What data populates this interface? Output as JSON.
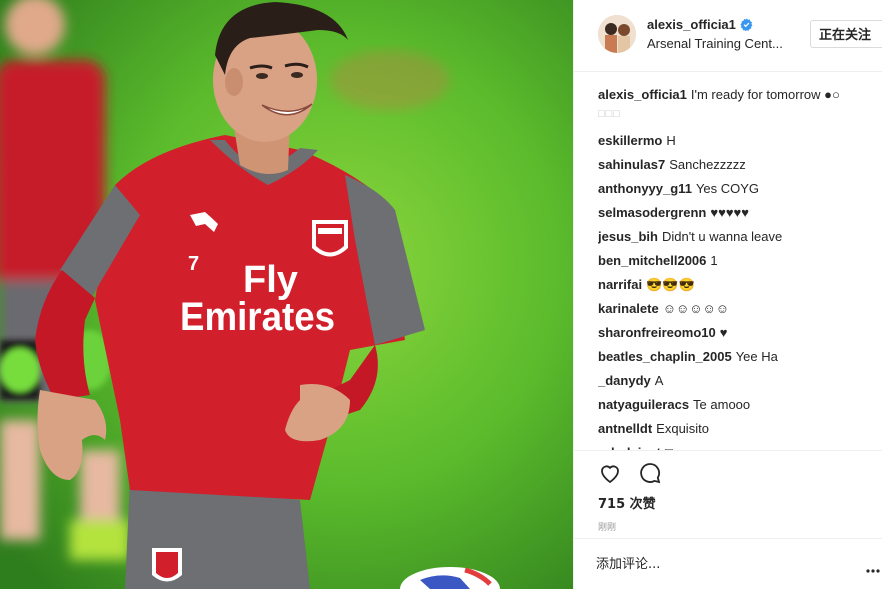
{
  "post": {
    "owner": "alexis_officia1",
    "location": "Arsenal Training Cent...",
    "follow_label": "正在关注",
    "photo": {
      "jersey_text_line1": "Fly",
      "jersey_text_line2": "Emirates",
      "jersey_number": "7"
    }
  },
  "caption": {
    "username": "alexis_officia1",
    "text": "I'm ready for tomorrow ●○",
    "extra": "□□□"
  },
  "comments": [
    {
      "username": "eskillermo",
      "text": "H"
    },
    {
      "username": "sahinulas7",
      "text": "Sanchezzzzz"
    },
    {
      "username": "anthonyyy_g11",
      "text": "Yes COYG"
    },
    {
      "username": "selmasodergrenn",
      "text": "♥♥♥♥♥"
    },
    {
      "username": "jesus_bih",
      "text": "Didn't u wanna leave"
    },
    {
      "username": "ben_mitchell2006",
      "text": "1"
    },
    {
      "username": "narrifai",
      "text": "😎😎😎"
    },
    {
      "username": "karinalete",
      "text": "☺☺☺☺☺"
    },
    {
      "username": "sharonfreireomo10",
      "text": "♥"
    },
    {
      "username": "beatles_chaplin_2005",
      "text": "Yee Ha"
    },
    {
      "username": "_danydy",
      "text": "A"
    },
    {
      "username": "natyaguileracs",
      "text": "Te amooo"
    },
    {
      "username": "antnelldt",
      "text": "Exquisito"
    },
    {
      "username": "ruhul_just",
      "text": "□"
    }
  ],
  "actions": {
    "likes": "715 次赞",
    "timestamp": "刚刚",
    "add_comment_placeholder": "添加评论...",
    "icons": [
      "heart-icon",
      "comment-icon",
      "more-icon",
      "verified-icon"
    ]
  },
  "colors": {
    "text": "#262626",
    "border": "#efefef",
    "verified": "#3897f0",
    "jersey_red": "#d11f2c",
    "jersey_grey": "#6d6f73",
    "pitch_green": "#55b32a"
  }
}
